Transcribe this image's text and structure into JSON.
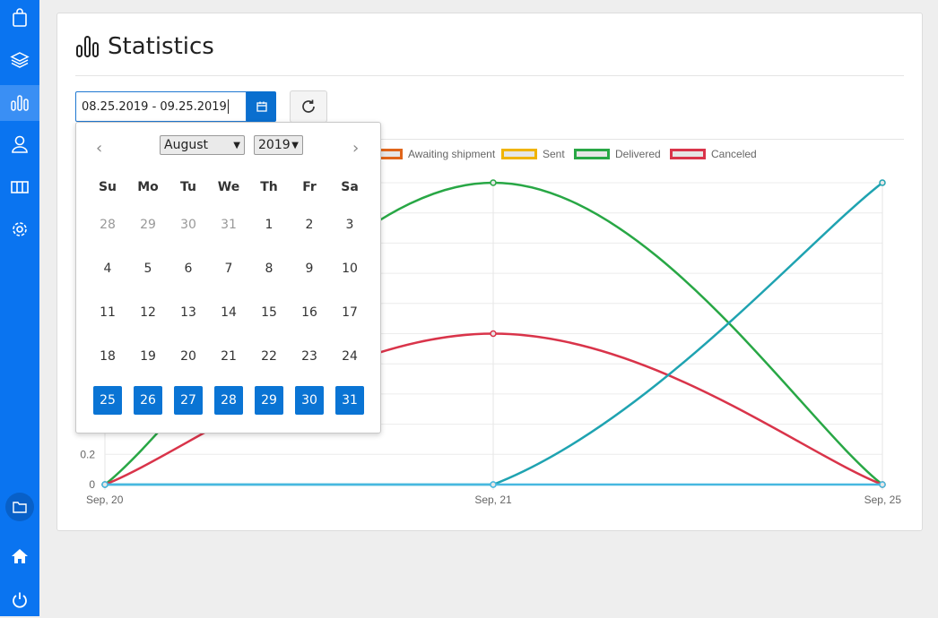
{
  "page": {
    "title": "Statistics",
    "date_range_value": "08.25.2019 - 09.25.2019"
  },
  "colors": {
    "sidebar": "#0a74f0",
    "primary": "#0a6fcf",
    "awaiting": "#e0651a",
    "sent": "#f0b400",
    "delivered": "#28a745",
    "canceled": "#d9344a",
    "teal": "#1fa3b1"
  },
  "sidebar": {
    "items": [
      {
        "icon": "shopping-bag-icon"
      },
      {
        "icon": "layers-icon"
      },
      {
        "icon": "bar-chart-icon",
        "active": true
      },
      {
        "icon": "user-icon"
      },
      {
        "icon": "map-icon"
      },
      {
        "icon": "gear-icon"
      },
      {
        "icon": "folder-icon"
      },
      {
        "icon": "home-icon"
      },
      {
        "icon": "power-icon"
      }
    ]
  },
  "datepicker": {
    "month": "August",
    "year": "2019",
    "prev": "‹",
    "next": "›",
    "weekdays": [
      "Su",
      "Mo",
      "Tu",
      "We",
      "Th",
      "Fr",
      "Sa"
    ],
    "weeks": [
      [
        "28",
        "29",
        "30",
        "31",
        "1",
        "2",
        "3"
      ],
      [
        "4",
        "5",
        "6",
        "7",
        "8",
        "9",
        "10"
      ],
      [
        "11",
        "12",
        "13",
        "14",
        "15",
        "16",
        "17"
      ],
      [
        "18",
        "19",
        "20",
        "21",
        "22",
        "23",
        "24"
      ],
      [
        "25",
        "26",
        "27",
        "28",
        "29",
        "30",
        "31"
      ]
    ],
    "muted_first_week": [
      true,
      true,
      true,
      true,
      false,
      false,
      false
    ],
    "selected_last_week": true
  },
  "chart_data": {
    "type": "line",
    "categories": [
      "Sep, 20",
      "Sep, 21",
      "Sep, 25"
    ],
    "y_ticks_visible": [
      "0",
      "0.2"
    ],
    "legend": [
      "Awaiting shipment",
      "Sent",
      "Delivered",
      "Canceled"
    ],
    "series": [
      {
        "name": "Delivered",
        "color": "#28a745",
        "values": [
          0,
          2,
          0
        ]
      },
      {
        "name": "Canceled",
        "color": "#d9344a",
        "values": [
          0,
          1,
          0
        ]
      },
      {
        "color": "#1fa3b1",
        "values": [
          0,
          0,
          2
        ]
      },
      {
        "color": "#47b8e0",
        "values": [
          0,
          0,
          0
        ]
      }
    ],
    "ylim": [
      0,
      2
    ]
  }
}
